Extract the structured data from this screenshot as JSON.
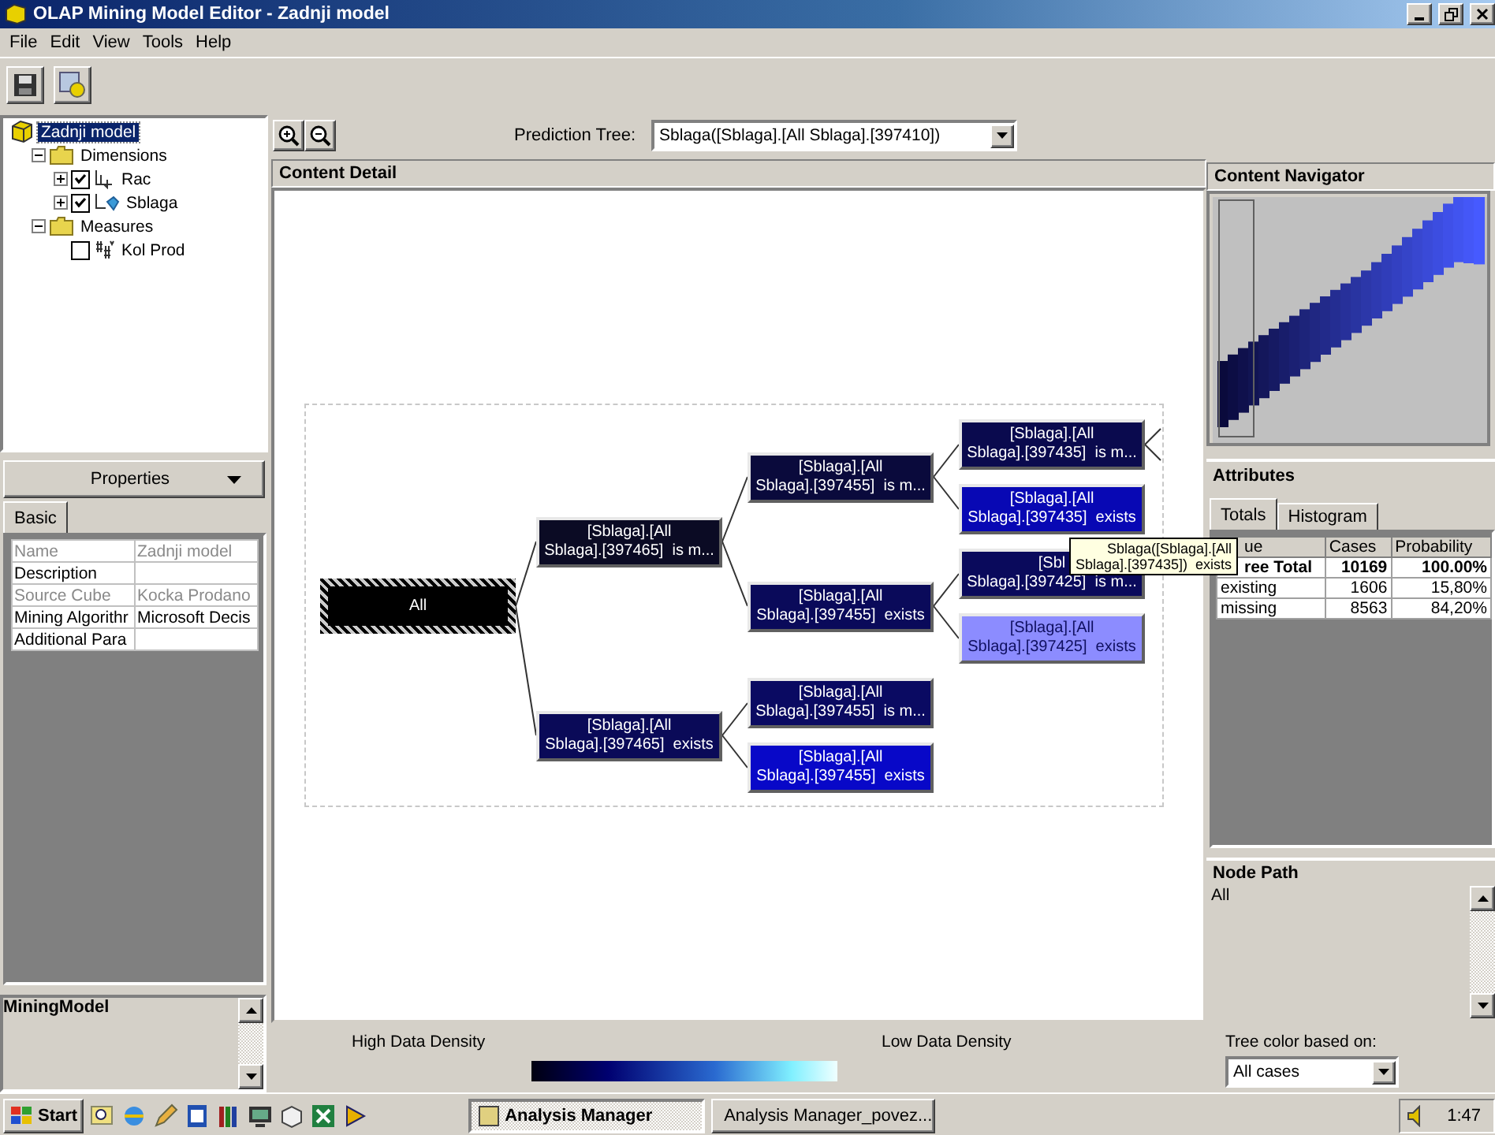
{
  "window": {
    "title": "OLAP Mining Model Editor - Zadnji model"
  },
  "menu": [
    "File",
    "Edit",
    "View",
    "Tools",
    "Help"
  ],
  "model_tree": [
    {
      "label": "Zadnji model",
      "kind": "model",
      "selected": true,
      "children": [
        {
          "label": "Dimensions",
          "kind": "folder",
          "expanded": true,
          "selected": false,
          "children": [
            {
              "label": "Rac",
              "kind": "dimension",
              "expanded": false,
              "checked": true,
              "selected": false
            },
            {
              "label": "Sblaga",
              "kind": "predictable",
              "expanded": false,
              "checked": true,
              "selected": false
            }
          ]
        },
        {
          "label": "Measures",
          "kind": "folder",
          "expanded": true,
          "selected": false,
          "children": [
            {
              "label": "Kol Prod",
              "kind": "measure",
              "checked": false,
              "selected": false
            }
          ]
        }
      ]
    }
  ],
  "properties": {
    "title": "Properties",
    "tabs": [
      {
        "label": "Basic",
        "selected": true
      }
    ],
    "rows": [
      {
        "name": "Name",
        "value": "Zadnji model",
        "disabled": true
      },
      {
        "name": "Description",
        "disabled": false
      },
      {
        "name": "Source Cube",
        "value": "Kocka Prodano",
        "disabled": true
      },
      {
        "name": "Mining Algorithr",
        "value": "Microsoft Decis",
        "disabled": false
      },
      {
        "name": "Additional Para",
        "disabled": false
      }
    ]
  },
  "description_panel": {
    "title": "MiningModel"
  },
  "prediction_tree": {
    "label": "Prediction Tree:",
    "value": "Sblaga([Sblaga].[All Sblaga].[397410])"
  },
  "content_detail": {
    "title": "Content Detail",
    "tree": {
      "lines": [
        "All"
      ],
      "color": "#000000",
      "selected": true,
      "children": [
        {
          "lines": [
            "[Sblaga].[All",
            "Sblaga].[397465]  is m..."
          ],
          "color": "#0b0b24",
          "selected": false,
          "children": [
            {
              "lines": [
                "[Sblaga].[All",
                "Sblaga].[397455]  is m..."
              ],
              "color": "#0a0a3c",
              "selected": false,
              "children": [
                {
                  "lines": [
                    "[Sblaga].[All",
                    "Sblaga].[397435]  is m..."
                  ],
                  "color": "#0a0a4e",
                  "selected": false,
                  "children_offscreen": true
                },
                {
                  "lines": [
                    "[Sblaga].[All",
                    "Sblaga].[397435]  exists"
                  ],
                  "color": "#0808b4",
                  "selected": false
                }
              ]
            },
            {
              "lines": [
                "[Sblaga].[All",
                "Sblaga].[397455]  exists"
              ],
              "color": "#0a0a5a",
              "selected": false,
              "children": [
                {
                  "lines": [
                    "[Sbl",
                    "Sblaga].[397425]  is m..."
                  ],
                  "color": "#0a0a5c",
                  "selected": false
                },
                {
                  "lines": [
                    "[Sblaga].[All",
                    "Sblaga].[397425]  exists"
                  ],
                  "color": "#8c8cff",
                  "selected": false
                }
              ]
            }
          ]
        },
        {
          "lines": [
            "[Sblaga].[All",
            "Sblaga].[397465]  exists"
          ],
          "color": "#0a0a58",
          "selected": false,
          "children": [
            {
              "lines": [
                "[Sblaga].[All",
                "Sblaga].[397455]  is m..."
              ],
              "color": "#0a0a62",
              "selected": false
            },
            {
              "lines": [
                "[Sblaga].[All",
                "Sblaga].[397455]  exists"
              ],
              "color": "#0808c8",
              "selected": false
            }
          ]
        }
      ]
    },
    "tooltip": [
      "Sblaga([Sblaga].[All",
      "Sblaga].[397435])  exists"
    ]
  },
  "content_navigator": {
    "title": "Content Navigator"
  },
  "attributes": {
    "title": "Attributes",
    "tabs": [
      {
        "label": "Totals",
        "selected": true
      },
      {
        "label": "Histogram",
        "selected": false
      }
    ],
    "columns": [
      "ue",
      "Cases",
      "Probability"
    ],
    "rows": [
      {
        "cells": [
          "ree Total",
          "10169",
          "100.00%"
        ],
        "total": true
      },
      {
        "cells": [
          "existing",
          "1606",
          "15,80%"
        ],
        "total": false
      },
      {
        "cells": [
          "missing",
          "8563",
          "84,20%"
        ],
        "total": false
      }
    ]
  },
  "node_path": {
    "title": "Node Path",
    "text": "All"
  },
  "legend": {
    "high": "High Data Density",
    "low": "Low Data Density"
  },
  "tree_color": {
    "label": "Tree color based on:",
    "value": "All cases"
  },
  "taskbar": {
    "start": "Start",
    "tasks": [
      {
        "label": "Analysis Manager",
        "selected": true
      },
      {
        "label": "Analysis Manager_povez...",
        "selected": false
      }
    ],
    "clock": "1:47"
  }
}
